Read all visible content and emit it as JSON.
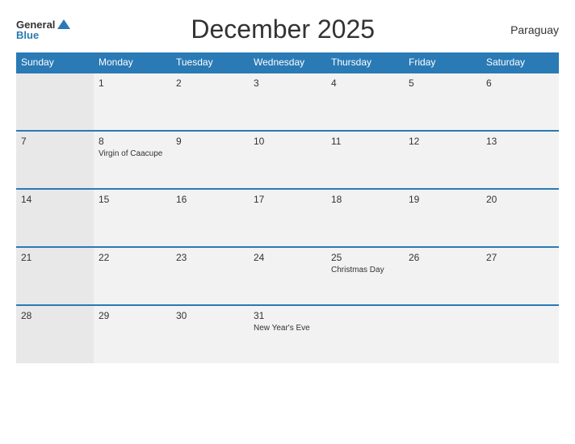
{
  "header": {
    "logo_general": "General",
    "logo_blue": "Blue",
    "title": "December 2025",
    "country": "Paraguay"
  },
  "weekdays": [
    "Sunday",
    "Monday",
    "Tuesday",
    "Wednesday",
    "Thursday",
    "Friday",
    "Saturday"
  ],
  "weeks": [
    [
      {
        "day": "",
        "event": ""
      },
      {
        "day": "1",
        "event": ""
      },
      {
        "day": "2",
        "event": ""
      },
      {
        "day": "3",
        "event": ""
      },
      {
        "day": "4",
        "event": ""
      },
      {
        "day": "5",
        "event": ""
      },
      {
        "day": "6",
        "event": ""
      }
    ],
    [
      {
        "day": "7",
        "event": ""
      },
      {
        "day": "8",
        "event": "Virgin of Caacupe"
      },
      {
        "day": "9",
        "event": ""
      },
      {
        "day": "10",
        "event": ""
      },
      {
        "day": "11",
        "event": ""
      },
      {
        "day": "12",
        "event": ""
      },
      {
        "day": "13",
        "event": ""
      }
    ],
    [
      {
        "day": "14",
        "event": ""
      },
      {
        "day": "15",
        "event": ""
      },
      {
        "day": "16",
        "event": ""
      },
      {
        "day": "17",
        "event": ""
      },
      {
        "day": "18",
        "event": ""
      },
      {
        "day": "19",
        "event": ""
      },
      {
        "day": "20",
        "event": ""
      }
    ],
    [
      {
        "day": "21",
        "event": ""
      },
      {
        "day": "22",
        "event": ""
      },
      {
        "day": "23",
        "event": ""
      },
      {
        "day": "24",
        "event": ""
      },
      {
        "day": "25",
        "event": "Christmas Day"
      },
      {
        "day": "26",
        "event": ""
      },
      {
        "day": "27",
        "event": ""
      }
    ],
    [
      {
        "day": "28",
        "event": ""
      },
      {
        "day": "29",
        "event": ""
      },
      {
        "day": "30",
        "event": ""
      },
      {
        "day": "31",
        "event": "New Year's Eve"
      },
      {
        "day": "",
        "event": ""
      },
      {
        "day": "",
        "event": ""
      },
      {
        "day": "",
        "event": ""
      }
    ]
  ]
}
